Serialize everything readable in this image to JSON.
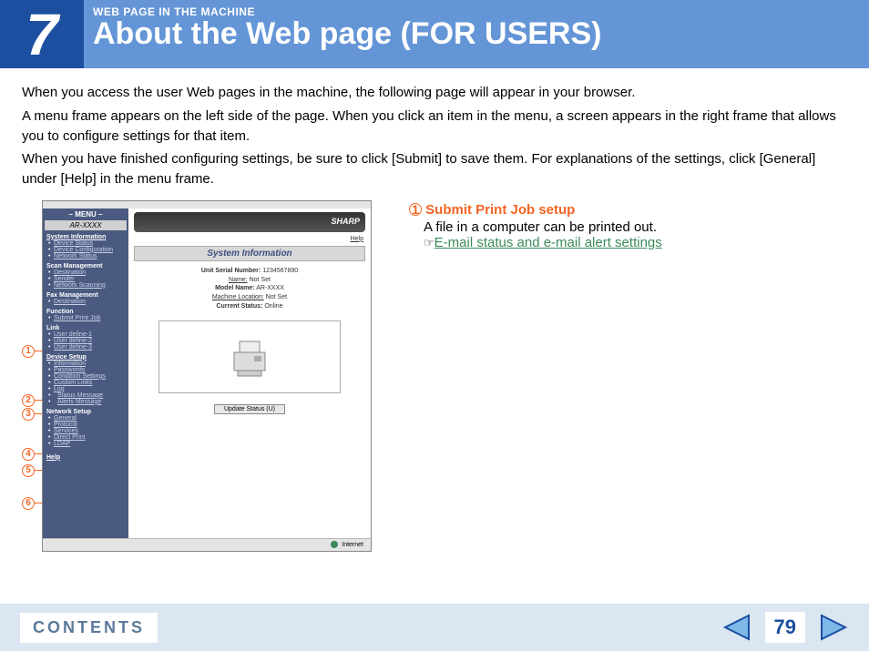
{
  "header": {
    "chapter_number": "7",
    "eyebrow": "WEB PAGE IN THE MACHINE",
    "title": "About the Web page (FOR USERS)"
  },
  "body": {
    "p1": "When you access the user Web pages in the machine, the following page will appear in your browser.",
    "p2": "A menu frame appears on the left side of the page. When you click an item in the menu, a screen appears in the right frame that allows you to configure settings for that item.",
    "p3": "When you have finished configuring settings, be sure to click [Submit] to save them. For explanations of the settings, click [General] under [Help] in the menu frame."
  },
  "info": {
    "num": "1",
    "title": "Submit Print Job setup",
    "desc": "A file in a computer can be printed out.",
    "link": "E-mail status and e-mail alert settings",
    "point": "☞"
  },
  "callouts": [
    "1",
    "2",
    "3",
    "4",
    "5",
    "6"
  ],
  "screenshot": {
    "menu_title": "– MENU –",
    "model": "AR-XXXX",
    "brand": "SHARP",
    "help": "Help",
    "sys_info_section": "System Information",
    "sys_items": [
      "Device Status",
      "Device Configuration",
      "Network Status"
    ],
    "scan_section": "Scan Management",
    "scan_items": [
      "Destination",
      "Sender",
      "Network Scanning"
    ],
    "fax_section": "Fax Management",
    "fax_items": [
      "Destination"
    ],
    "function_section": "Function",
    "function_items": [
      "Submit Print Job"
    ],
    "link_section": "Link",
    "link_items": [
      "User define-1",
      "User define-2",
      "User define-3"
    ],
    "device_section": "Device Setup",
    "device_items": [
      "Information",
      "Passwords",
      "Condition Settings",
      "Custom Links",
      "Log",
      "Status Message",
      "Alerts Message"
    ],
    "network_section": "Network Setup",
    "network_items": [
      "General",
      "Protocol",
      "Services",
      "Direct Print",
      "LDAP"
    ],
    "bottom_help": "Help",
    "main_title": "System Information",
    "rows": {
      "serial_lbl": "Unit Serial Number:",
      "serial_val": "1234567890",
      "name_lbl": "Name:",
      "name_val": "Not Set",
      "model_lbl": "Model Name:",
      "model_val": "AR-XXXX",
      "loc_lbl": "Machine Location:",
      "loc_val": "Not Set",
      "status_lbl": "Current Status:",
      "status_val": "Online"
    },
    "update_btn": "Update Status (U)",
    "status_bar": "Internet"
  },
  "footer": {
    "contents": "CONTENTS",
    "page": "79"
  }
}
